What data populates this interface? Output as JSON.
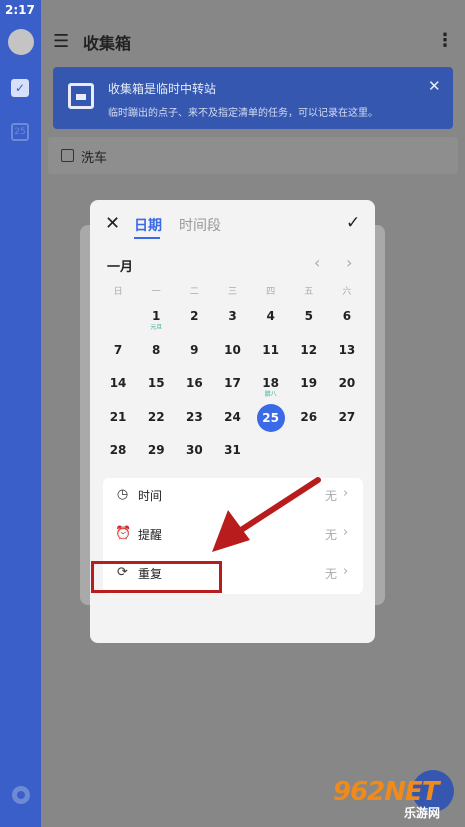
{
  "status": {
    "time": "2:17"
  },
  "sidebar": {
    "calendar_badge": "25"
  },
  "header": {
    "title": "收集箱"
  },
  "banner": {
    "title": "收集箱是临时中转站",
    "subtitle": "临时蹦出的点子、来不及指定清单的任务，可以记录在这里。"
  },
  "task": {
    "text": "洗车"
  },
  "dialog": {
    "tabs": [
      "日期",
      "时间段"
    ],
    "month": "一月",
    "weekdays": [
      "日",
      "一",
      "二",
      "三",
      "四",
      "五",
      "六"
    ],
    "days": [
      [
        "",
        "1",
        "2",
        "3",
        "4",
        "5",
        "6"
      ],
      [
        "7",
        "8",
        "9",
        "10",
        "11",
        "12",
        "13"
      ],
      [
        "14",
        "15",
        "16",
        "17",
        "18",
        "19",
        "20"
      ],
      [
        "21",
        "22",
        "23",
        "24",
        "25",
        "26",
        "27"
      ],
      [
        "28",
        "29",
        "30",
        "31",
        "",
        "",
        ""
      ]
    ],
    "lunar": {
      "1": "元旦",
      "18": "腊八"
    },
    "today": "25",
    "options": [
      {
        "label": "时间",
        "value": "无",
        "icon": "clock-icon"
      },
      {
        "label": "提醒",
        "value": "无",
        "icon": "alarm-icon"
      },
      {
        "label": "重复",
        "value": "无",
        "icon": "repeat-icon"
      }
    ]
  },
  "watermark": {
    "brand": "962NET",
    "sub": "乐游网"
  },
  "colors": {
    "accent": "#3b6ae6",
    "sidebar": "#3a5fc8",
    "annotation": "#b81c1c"
  }
}
